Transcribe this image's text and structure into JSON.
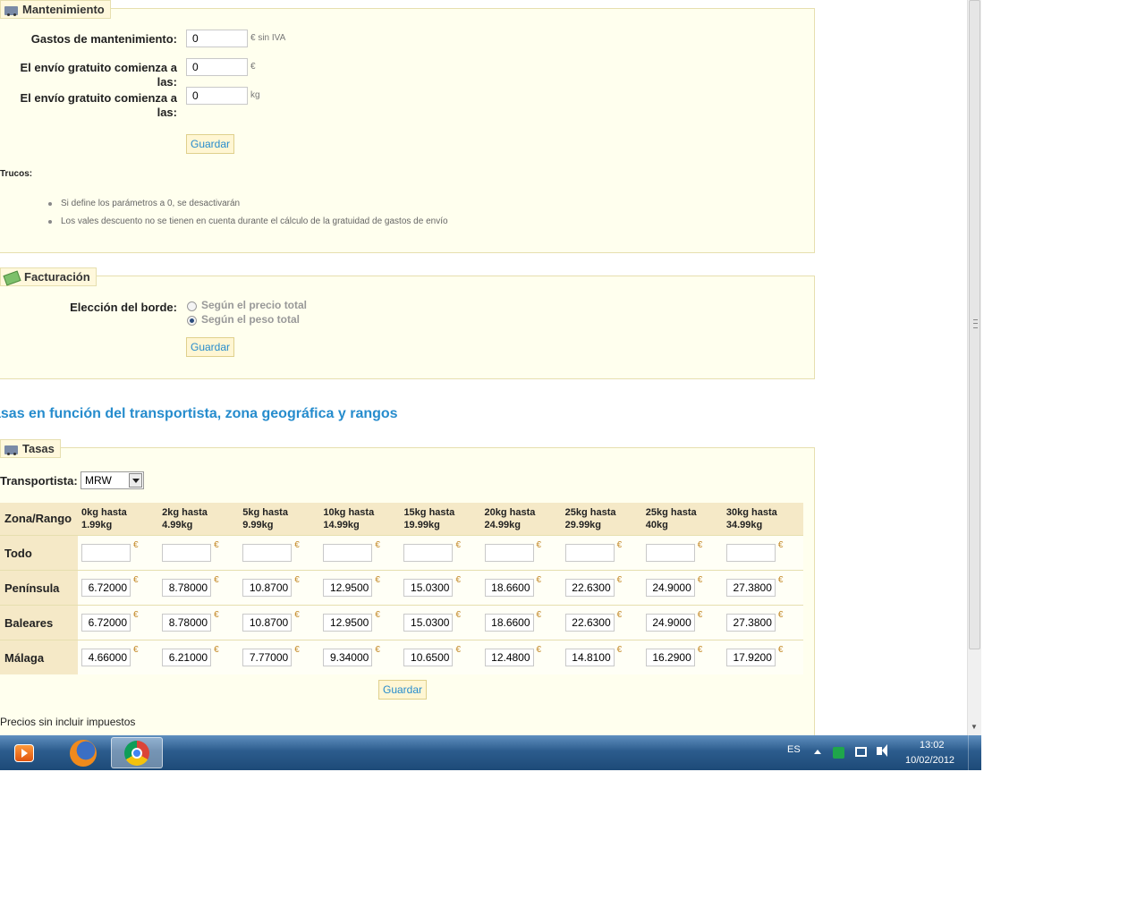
{
  "maintenance": {
    "legend": "Mantenimiento",
    "fields": [
      {
        "label": "Gastos de mantenimiento:",
        "value": "0",
        "unit": "€ sin IVA"
      },
      {
        "label": "El envío gratuito comienza a las:",
        "value": "0",
        "unit": "€"
      },
      {
        "label": "El envío gratuito comienza a las:",
        "value": "0",
        "unit": "kg"
      }
    ],
    "save_label": "Guardar",
    "tips_title": "Trucos:",
    "tips": [
      "Si define los parámetros a 0, se desactivarán",
      "Los vales descuento no se tienen en cuenta durante el cálculo de la gratuidad de gastos de envío"
    ]
  },
  "billing": {
    "legend": "Facturación",
    "label": "Elección del borde:",
    "options": [
      {
        "label": "Según el precio total",
        "selected": false
      },
      {
        "label": "Según el peso total",
        "selected": true
      }
    ],
    "save_label": "Guardar"
  },
  "section_title": "asas en función del transportista, zona geográfica y rangos",
  "rates": {
    "legend": "Tasas",
    "carrier_label": "Transportista:",
    "carrier_value": "MRW",
    "corner_header": "Zona/Rango",
    "ranges": [
      {
        "line1": "0kg hasta",
        "line2": "1.99kg"
      },
      {
        "line1": "2kg hasta",
        "line2": "4.99kg"
      },
      {
        "line1": "5kg hasta",
        "line2": "9.99kg"
      },
      {
        "line1": "10kg hasta",
        "line2": "14.99kg"
      },
      {
        "line1": "15kg hasta",
        "line2": "19.99kg"
      },
      {
        "line1": "20kg hasta",
        "line2": "24.99kg"
      },
      {
        "line1": "25kg hasta",
        "line2": "29.99kg"
      },
      {
        "line1": "25kg hasta",
        "line2": "40kg"
      },
      {
        "line1": "30kg hasta",
        "line2": "34.99kg"
      }
    ],
    "currency": "€",
    "zones": [
      {
        "name": "Todo",
        "values": [
          "",
          "",
          "",
          "",
          "",
          "",
          "",
          "",
          ""
        ]
      },
      {
        "name": "Península",
        "values": [
          "6.72000",
          "8.78000",
          "10.8700",
          "12.9500",
          "15.0300",
          "18.6600",
          "22.6300",
          "24.9000",
          "27.3800"
        ]
      },
      {
        "name": "Baleares",
        "values": [
          "6.72000",
          "8.78000",
          "10.8700",
          "12.9500",
          "15.0300",
          "18.6600",
          "22.6300",
          "24.9000",
          "27.3800"
        ]
      },
      {
        "name": "Málaga",
        "values": [
          "4.66000",
          "6.21000",
          "7.77000",
          "9.34000",
          "10.6500",
          "12.4800",
          "14.8100",
          "16.2900",
          "17.9200"
        ]
      }
    ],
    "save_label": "Guardar",
    "footnote": "Precios sin incluir impuestos"
  },
  "taskbar": {
    "apps": [
      {
        "name": "Windows Media Player",
        "icon": "media-player-icon"
      },
      {
        "name": "Firefox",
        "icon": "firefox-icon"
      },
      {
        "name": "Chrome",
        "icon": "chrome-icon"
      }
    ],
    "language": "ES",
    "time": "13:02",
    "date": "10/02/2012"
  }
}
